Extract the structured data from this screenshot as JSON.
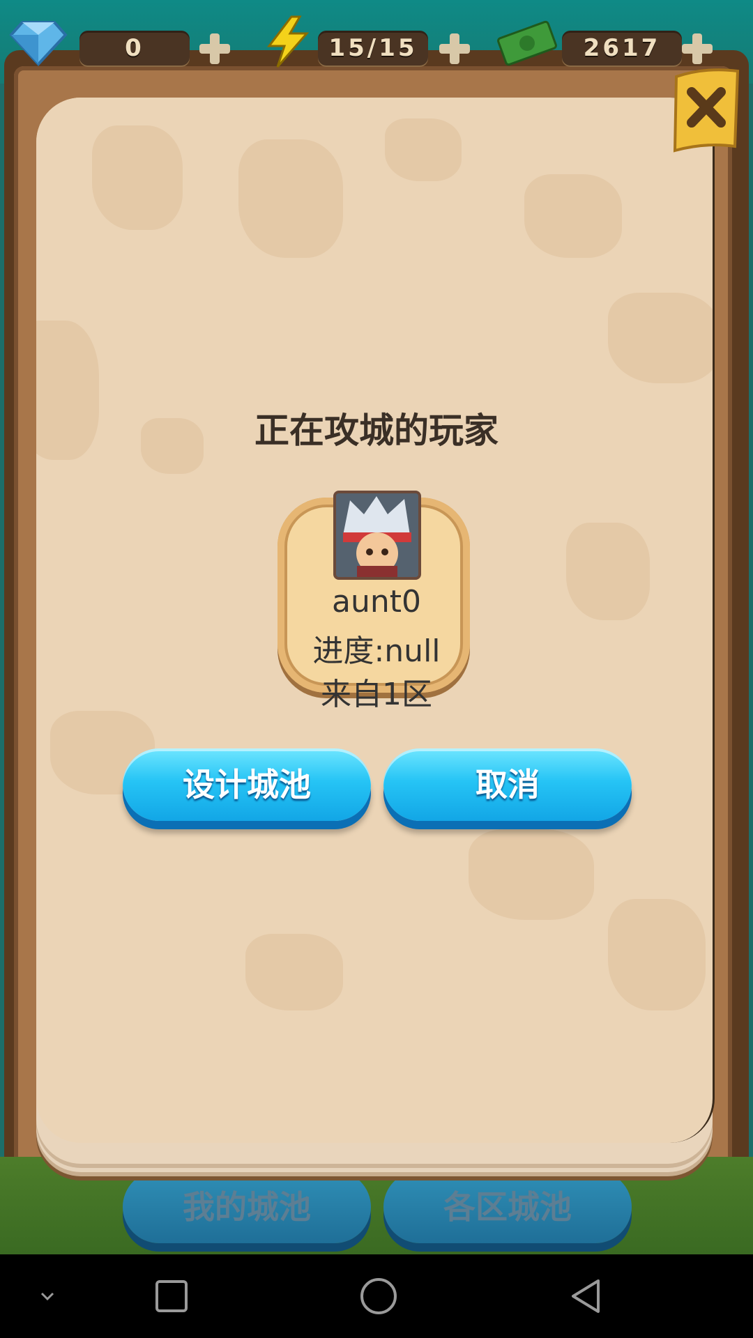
{
  "resources": {
    "gems": {
      "icon": "diamond-icon",
      "value": "0"
    },
    "energy": {
      "icon": "lightning-icon",
      "value": "15/15"
    },
    "money": {
      "icon": "cash-icon",
      "value": "2617"
    }
  },
  "dialog": {
    "title": "正在攻城的玩家",
    "close_icon": "close-icon",
    "player": {
      "avatar_icon": "ninja-avatar",
      "name": "aunt0",
      "progress": "进度:null",
      "origin": "来自1区"
    },
    "buttons": {
      "design": "设计城池",
      "cancel": "取消"
    }
  },
  "background_tabs": {
    "my_city": "我的城池",
    "zone_cities": "各区城池"
  },
  "navbar": [
    "collapse-icon",
    "recents-icon",
    "home-icon",
    "back-icon"
  ],
  "colors": {
    "button_blue": "#26c4f5",
    "paper": "#ebd4b6",
    "frame_brown": "#a8764a"
  }
}
